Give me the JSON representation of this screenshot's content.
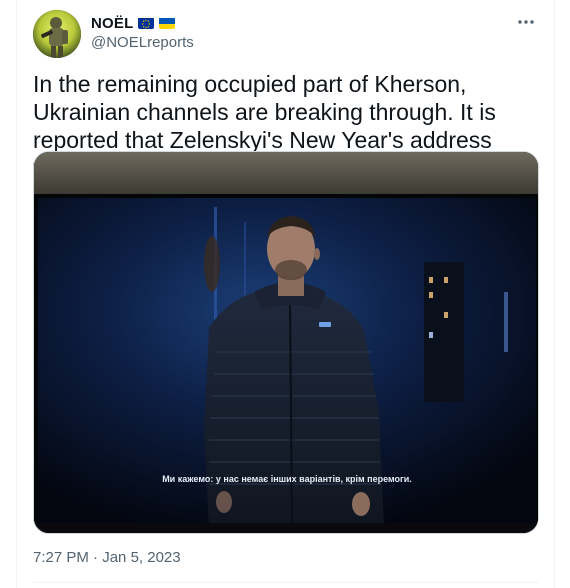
{
  "author": {
    "display_name": "NOËL",
    "handle": "@NOELreports",
    "badges": [
      "eu-flag-icon",
      "ukraine-flag-icon"
    ],
    "avatar_icon": "soldier-avatar-icon"
  },
  "tweet": {
    "text": "In the remaining occupied part of Kherson, Ukrainian channels are breaking through. It is reported that Zelenskyi's New Year's address was shown.",
    "time": "7:27 PM",
    "separator": "·",
    "date": "Jan 5, 2023"
  },
  "media": {
    "subtitle": "Ми кажемо: у нас немає інших варіантів, крім перемоги."
  },
  "colors": {
    "text_primary": "#0f1419",
    "text_secondary": "#536471",
    "border": "#cfd9de",
    "eu_blue": "#003399",
    "eu_gold": "#ffcc00",
    "ua_blue": "#0057b7",
    "ua_yellow": "#ffd700"
  },
  "icons": {
    "more": "more-horizontal-icon"
  }
}
